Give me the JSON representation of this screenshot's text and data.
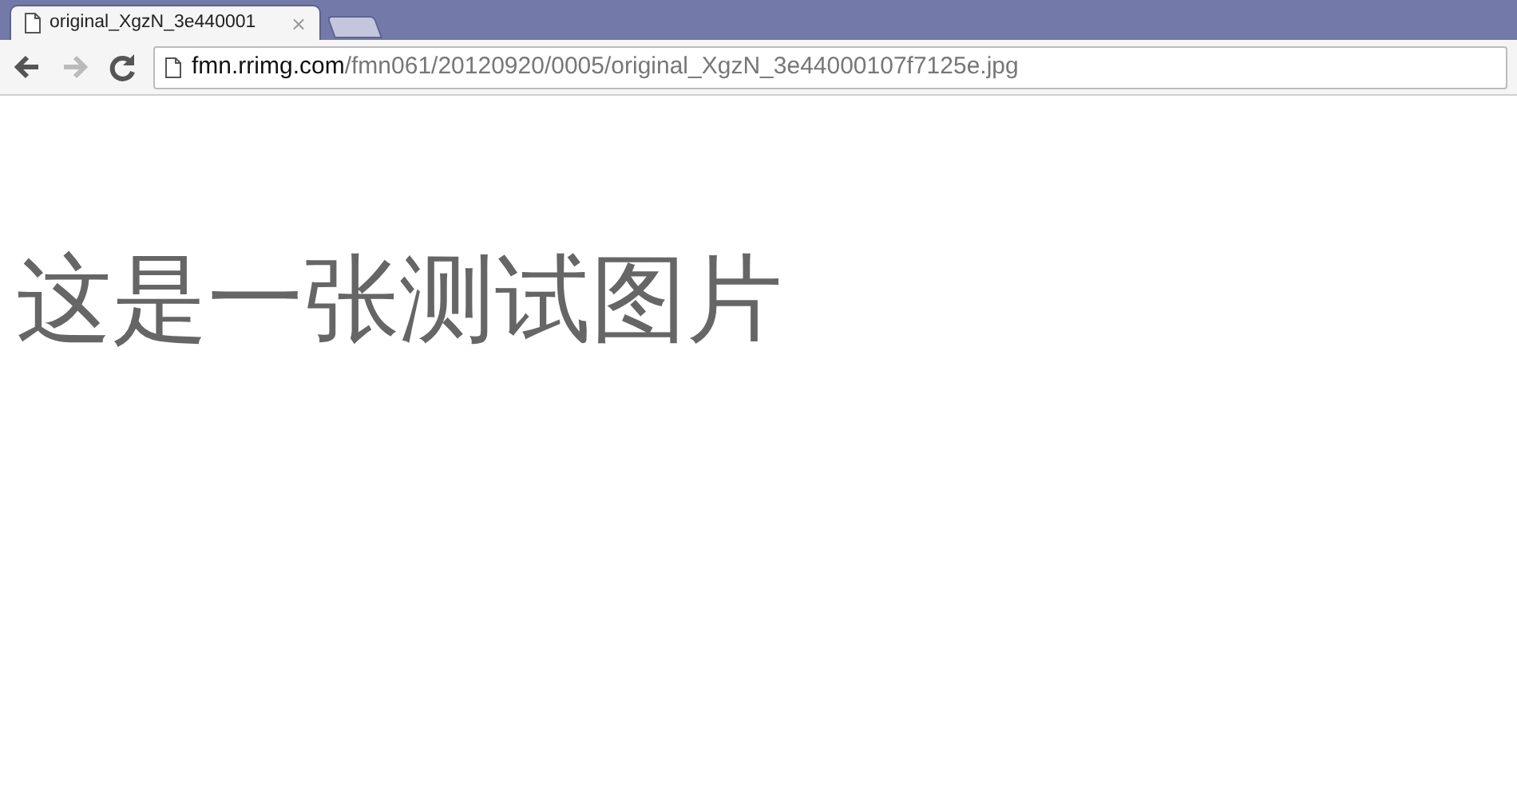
{
  "tabs": [
    {
      "title": "original_XgzN_3e440001",
      "close": "×",
      "selected": true
    }
  ],
  "toolbar": {
    "back": {
      "disabled": false
    },
    "forward": {
      "disabled": true
    },
    "reload": {
      "disabled": false
    }
  },
  "address": {
    "host": "fmn.rrimg.com",
    "path": "/fmn061/20120920/0005/original_XgzN_3e44000107f7125e.jpg"
  },
  "content": {
    "text": "这是一张测试图片"
  }
}
